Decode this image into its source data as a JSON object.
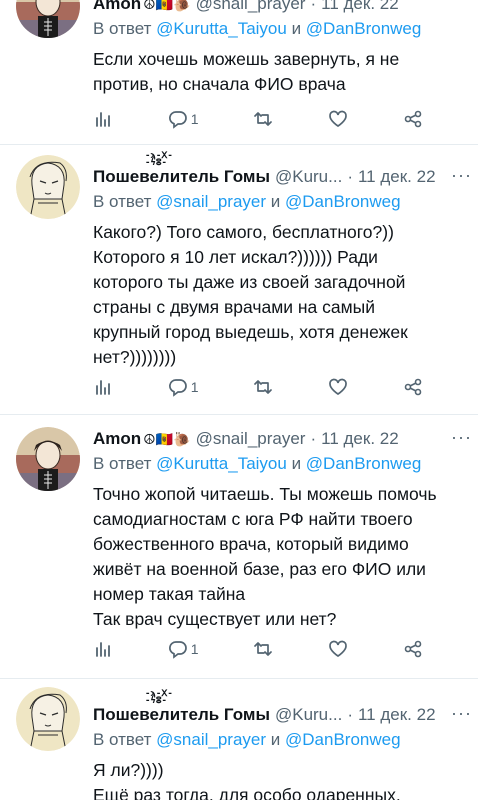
{
  "tweets": [
    {
      "name": "Amon",
      "emoji": "☮🇲🇩🐌",
      "handle": "@snail_prayer",
      "date": "11 дек. 22",
      "reply_prefix": "В ответ ",
      "reply_to_1": "@Kurutta_Taiyou",
      "reply_and": " и ",
      "reply_to_2": "@DanBronweg",
      "text": "Если хочешь можешь завернуть, я не\nпротив, но сначала ФИО врача",
      "replies": "1",
      "retweets": "",
      "likes": ""
    },
    {
      "name": "Пошевелитель Гомы",
      "emoji": "",
      "handle": "@Kuru...",
      "date": "11 дек. 22",
      "reply_prefix": "В ответ ",
      "reply_to_1": "@snail_prayer",
      "reply_and": " и ",
      "reply_to_2": "@DanBronweg",
      "text": "Какого?) Того самого, бесплатного?))\nКоторого я 10 лет искал?)))))) Ради\nкоторого ты даже из своей загадочной\nстраны с двумя врачами на самый\nкрупный город выедешь, хотя денежек\nнет?))))))))",
      "replies": "1",
      "retweets": "",
      "likes": ""
    },
    {
      "name": "Amon",
      "emoji": "☮🇲🇩🐌",
      "handle": "@snail_prayer",
      "date": "11 дек. 22",
      "reply_prefix": "В ответ ",
      "reply_to_1": "@Kurutta_Taiyou",
      "reply_and": " и ",
      "reply_to_2": "@DanBronweg",
      "text": "Точно жопой читаешь. Ты можешь помочь\nсамодиагностам с юга РФ найти твоего\nбожественного врача, который видимо\nживёт на военной базе, раз его ФИО или\nномер такая тайна\nТак врач существует или нет?",
      "replies": "1",
      "retweets": "",
      "likes": ""
    },
    {
      "name": "Пошевелитель Гомы",
      "emoji": "",
      "handle": "@Kuru...",
      "date": "11 дек. 22",
      "reply_prefix": "В ответ ",
      "reply_to_1": "@snail_prayer",
      "reply_and": " и ",
      "reply_to_2": "@DanBronweg",
      "text": "Я ли?))))\nЕщё раз тогда, для особо одаренных,",
      "replies": "",
      "retweets": "",
      "likes": ""
    }
  ],
  "icons": {
    "views": "bar-chart-icon",
    "reply": "reply-bubble-icon",
    "retweet": "retweet-icon",
    "like": "heart-icon",
    "share": "share-icon",
    "more": "more-dots-icon"
  },
  "more_label": "···",
  "colors": {
    "link": "#1d9bf0",
    "secondary": "#536471",
    "text": "#0f1419",
    "divider": "#e6ecf0"
  }
}
